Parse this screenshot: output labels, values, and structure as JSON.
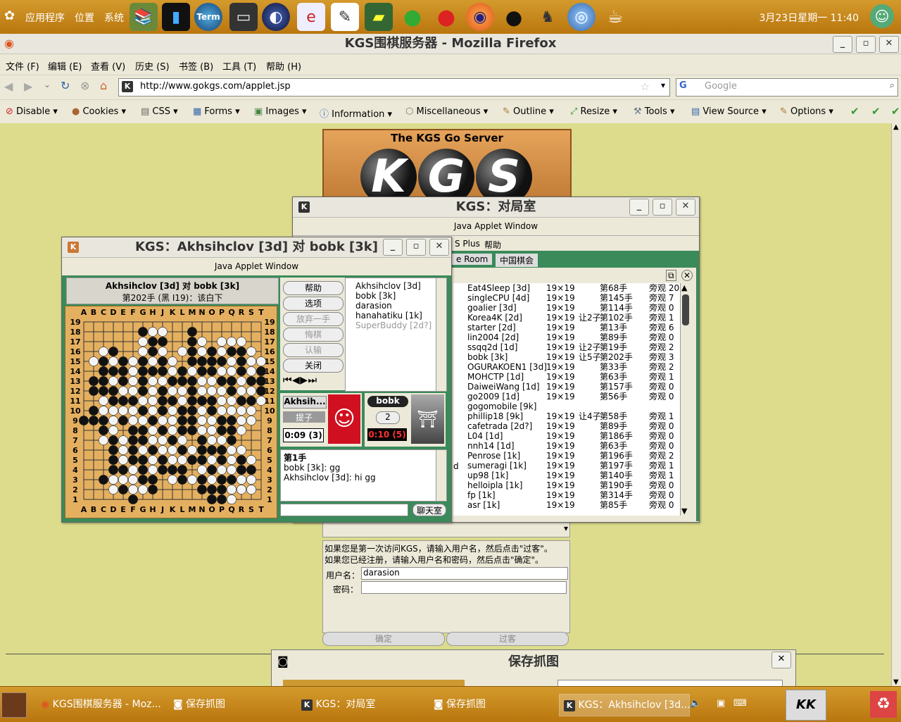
{
  "top_panel": {
    "menus": [
      "应用程序",
      "位置",
      "系统"
    ],
    "launchers": [
      "books-icon",
      "monitor-icon",
      "terminal-icon",
      "console-icon",
      "eclipse-icon",
      "ie-icon",
      "notepad-icon",
      "book-icon",
      "apple-green-icon",
      "apple-red-icon",
      "firefox-icon",
      "qq-icon",
      "gimp-icon",
      "earth-icon",
      "coffee-icon"
    ],
    "launcher_labels": {
      "term": "Term"
    },
    "clock": "3月23日星期一 11:40"
  },
  "firefox": {
    "title": "KGS围棋服务器 - Mozilla Firefox",
    "menu": [
      "文件 (F)",
      "编辑 (E)",
      "查看 (V)",
      "历史 (S)",
      "书签 (B)",
      "工具 (T)",
      "帮助 (H)"
    ],
    "url": "http://www.gokgs.com/applet.jsp",
    "search_placeholder": "Google",
    "devbar": [
      "Disable",
      "Cookies",
      "CSS",
      "Forms",
      "Images",
      "Information",
      "Miscellaneous",
      "Outline",
      "Resize",
      "Tools",
      "View Source",
      "Options"
    ]
  },
  "kgs_header": {
    "title": "The KGS Go Server",
    "logo": [
      "K",
      "G",
      "S"
    ]
  },
  "login": {
    "info1": "如果您是第一次访问KGS，请输入用户名，然后点击\"过客\"。",
    "info2": "如果您已经注册，请输入用户名和密码，然后点击\"确定\"。",
    "username_label": "用户名：",
    "username_value": "darasion",
    "password_label": "密码：",
    "ok": "确定",
    "guest": "过客"
  },
  "room_window": {
    "title": "KGS：对局室",
    "applet": "Java Applet Window",
    "menu_partial": "S Plus",
    "help": "帮助",
    "tabs": [
      "e Room",
      "中国棋会"
    ],
    "games": [
      {
        "player": "Eat4Sleep [3d]",
        "size": "19×19",
        "handicap": "",
        "move": "第68手",
        "obs": "旁观 20"
      },
      {
        "player": "singleCPU [4d]",
        "size": "19×19",
        "handicap": "",
        "move": "第145手",
        "obs": "旁观 7"
      },
      {
        "player": "goalier [3d]",
        "size": "19×19",
        "handicap": "",
        "move": "第114手",
        "obs": "旁观 0"
      },
      {
        "player": "Korea4K [2d]",
        "size": "19×19",
        "handicap": "让2子",
        "move": "第102手",
        "obs": "旁观 1"
      },
      {
        "player": "starter [2d]",
        "size": "19×19",
        "handicap": "",
        "move": "第13手",
        "obs": "旁观 6"
      },
      {
        "player": "lin2004 [2d]",
        "size": "19×19",
        "handicap": "",
        "move": "第89手",
        "obs": "旁观 0"
      },
      {
        "player": "ssqq2d [1d]",
        "size": "19×19",
        "handicap": "让2子",
        "move": "第19手",
        "obs": "旁观 2"
      },
      {
        "player": "bobk [3k]",
        "size": "19×19",
        "handicap": "让5子",
        "move": "第202手",
        "obs": "旁观 3"
      },
      {
        "player": "OGURAKOEN1 [3d]",
        "size": "19×19",
        "handicap": "",
        "move": "第33手",
        "obs": "旁观 2"
      },
      {
        "player": "MOHCTP [1d]",
        "size": "19×19",
        "handicap": "",
        "move": "第63手",
        "obs": "旁观 1"
      },
      {
        "player": "DaiweiWang [1d]",
        "size": "19×19",
        "handicap": "",
        "move": "第157手",
        "obs": "旁观 0"
      },
      {
        "player": "go2009 [1d]",
        "size": "19×19",
        "handicap": "",
        "move": "第56手",
        "obs": "旁观 0"
      },
      {
        "player": "gogomobile [9k]",
        "size": "",
        "handicap": "",
        "move": "",
        "obs": ""
      },
      {
        "player": "phillip18 [9k]",
        "size": "19×19",
        "handicap": "让4子",
        "move": "第58手",
        "obs": "旁观 1"
      },
      {
        "player": "cafetrada [2d?]",
        "size": "19×19",
        "handicap": "",
        "move": "第89手",
        "obs": "旁观 0"
      },
      {
        "player": "L04 [1d]",
        "size": "19×19",
        "handicap": "",
        "move": "第186手",
        "obs": "旁观 0"
      },
      {
        "player": "nnh14 [1d]",
        "size": "19×19",
        "handicap": "",
        "move": "第63手",
        "obs": "旁观 0"
      },
      {
        "player": "Penrose [1k]",
        "size": "19×19",
        "handicap": "",
        "move": "第196手",
        "obs": "旁观 2"
      },
      {
        "player": "sumeragi [1k]",
        "size": "19×19",
        "handicap": "",
        "move": "第197手",
        "obs": "旁观 1"
      },
      {
        "player": "up98 [1k]",
        "size": "19×19",
        "handicap": "",
        "move": "第140手",
        "obs": "旁观 1"
      },
      {
        "player": "helloipla [1k]",
        "size": "19×19",
        "handicap": "",
        "move": "第190手",
        "obs": "旁观 0"
      },
      {
        "player": "fp [1k]",
        "size": "19×19",
        "handicap": "",
        "move": "第314手",
        "obs": "旁观 0"
      },
      {
        "player": "asr [1k]",
        "size": "19×19",
        "handicap": "",
        "move": "第85手",
        "obs": "旁观 0"
      }
    ],
    "left_partial": "d"
  },
  "game_window": {
    "title": "KGS：Akhsihclov [3d] 对 bobk [3k]",
    "applet": "Java Applet Window",
    "header": "Akhsihclov [3d] 对 bobk [3k]",
    "status": "第202手 (黑 I19)：该白下",
    "columns": [
      "A",
      "B",
      "C",
      "D",
      "E",
      "F",
      "G",
      "H",
      "J",
      "K",
      "L",
      "M",
      "N",
      "O",
      "P",
      "Q",
      "R",
      "S",
      "T"
    ],
    "rows": [
      "19",
      "18",
      "17",
      "16",
      "15",
      "14",
      "13",
      "12",
      "11",
      "10",
      "9",
      "8",
      "7",
      "6",
      "5",
      "4",
      "3",
      "2",
      "1"
    ],
    "buttons": [
      "帮助",
      "选项",
      "放弃一手",
      "悔棋",
      "认输",
      "关闭"
    ],
    "players": [
      "Akhsihclov [3d]",
      "bobk [3k]",
      "darasion",
      "hanahatiku [1k]",
      "SuperBuddy [2d?]"
    ],
    "black_name": "Akhsih...",
    "black_captures_btn": "提子",
    "black_time": "0:09 (3)",
    "white_name": "bobk",
    "white_captures": "2",
    "white_time": "0:10 (5)",
    "chat_title": "第1手",
    "chat": [
      "bobk [3k]: gg",
      "Akhsihclov [3d]: hi gg"
    ],
    "chat_button": "聊天室",
    "board": [
      "...................",
      "......BWW..B.......",
      "......WBB..BW.WWW..",
      "..WB..WBW.WBWBWBBW.",
      ".WBWBWBWBW.BBBBWBWW",
      "..BBBWBBBWBWBBWWBWB",
      ".BBWBWBWWBBBWWBBWBB",
      ".BBBWWBWBWWBWWWBWWB",
      "..WBBBWWBBWBBBWWBBW",
      ".BWWWWBWBWBBWBWWWW.",
      "BBBWBWWBWWBBWWBBWW.",
      "..BW.BBWBWBBWWBBW..",
      "..WBWBBWWBW.BWWB...",
      "...BWBWBWWBWBBBWW..",
      "...BWBBWBWWBBWBWBW.",
      "...BBWBWBBB.WBWWBB.",
      "..BWWWBB.WBWBWBBWW.",
      "...WBWWB....BBBWWW.",
      ".....B.......BBW..."
    ]
  },
  "save_dialog": {
    "title": "保存抓图"
  },
  "taskbar": {
    "tasks": [
      "KGS围棋服务器 - Moz...",
      "保存抓图",
      "KGS：对局室",
      "保存抓图",
      "KGS：Akhsihclov [3d..."
    ]
  }
}
